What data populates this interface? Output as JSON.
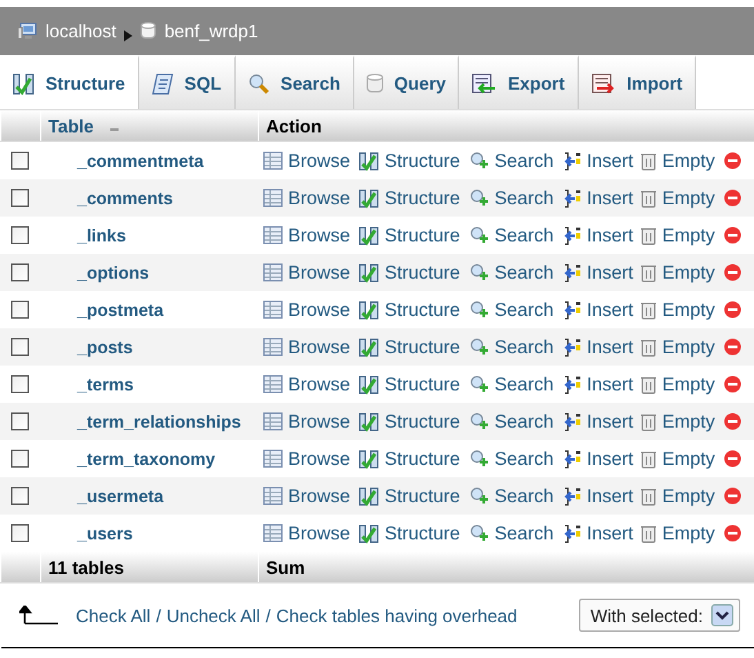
{
  "breadcrumb": {
    "server": "localhost",
    "database": "benf_wrdp1"
  },
  "tabs": [
    {
      "label": "Structure",
      "kind": "structure",
      "selected": true
    },
    {
      "label": "SQL",
      "kind": "sql",
      "selected": false
    },
    {
      "label": "Search",
      "kind": "search",
      "selected": false
    },
    {
      "label": "Query",
      "kind": "query",
      "selected": false
    },
    {
      "label": "Export",
      "kind": "export",
      "selected": false
    },
    {
      "label": "Import",
      "kind": "import",
      "selected": false
    }
  ],
  "table": {
    "columns": [
      "Table",
      "Action"
    ],
    "rows": [
      {
        "name": "_commentmeta",
        "checked": false,
        "actions": [
          "Browse",
          "Structure",
          "Search",
          "Insert",
          "Empty"
        ]
      },
      {
        "name": "_comments",
        "checked": false,
        "actions": [
          "Browse",
          "Structure",
          "Search",
          "Insert",
          "Empty"
        ]
      },
      {
        "name": "_links",
        "checked": false,
        "actions": [
          "Browse",
          "Structure",
          "Search",
          "Insert",
          "Empty"
        ]
      },
      {
        "name": "_options",
        "checked": false,
        "actions": [
          "Browse",
          "Structure",
          "Search",
          "Insert",
          "Empty"
        ]
      },
      {
        "name": "_postmeta",
        "checked": false,
        "actions": [
          "Browse",
          "Structure",
          "Search",
          "Insert",
          "Empty"
        ]
      },
      {
        "name": "_posts",
        "checked": false,
        "actions": [
          "Browse",
          "Structure",
          "Search",
          "Insert",
          "Empty"
        ]
      },
      {
        "name": "_terms",
        "checked": false,
        "actions": [
          "Browse",
          "Structure",
          "Search",
          "Insert",
          "Empty"
        ]
      },
      {
        "name": "_term_relationships",
        "checked": false,
        "actions": [
          "Browse",
          "Structure",
          "Search",
          "Insert",
          "Empty"
        ]
      },
      {
        "name": "_term_taxonomy",
        "checked": false,
        "actions": [
          "Browse",
          "Structure",
          "Search",
          "Insert",
          "Empty"
        ]
      },
      {
        "name": "_usermeta",
        "checked": false,
        "actions": [
          "Browse",
          "Structure",
          "Search",
          "Insert",
          "Empty"
        ]
      },
      {
        "name": "_users",
        "checked": false,
        "actions": [
          "Browse",
          "Structure",
          "Search",
          "Insert",
          "Empty"
        ]
      }
    ],
    "footer": {
      "count": "11 tables",
      "sum": "Sum"
    }
  },
  "bulk": {
    "links": [
      "Check All",
      "Uncheck All",
      "Check tables having overhead"
    ],
    "separator": "/",
    "select": "With selected:"
  }
}
